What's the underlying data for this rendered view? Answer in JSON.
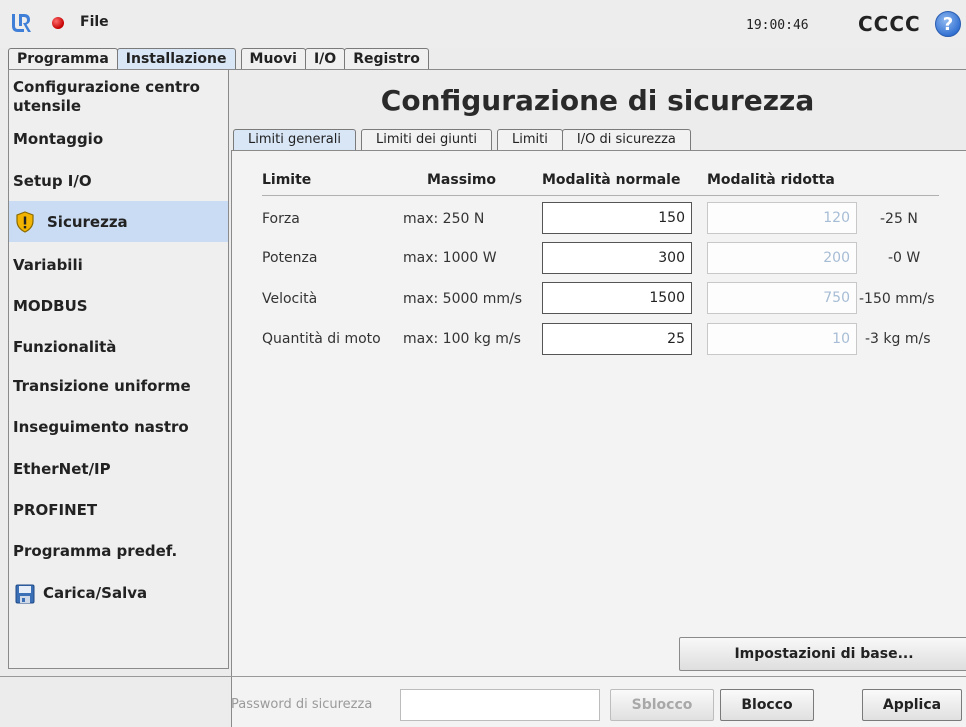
{
  "topbar": {
    "logo_icon": "ur-logo-icon",
    "status_icon": "record-red-icon",
    "file_label": "File",
    "clock": "19:00:46",
    "robot_name": "CCCC",
    "help_label": "?"
  },
  "main_tabs": [
    {
      "label": "Programma",
      "active": false
    },
    {
      "label": "Installazione",
      "active": true
    },
    {
      "label": "Muovi",
      "active": false
    },
    {
      "label": "I/O",
      "active": false
    },
    {
      "label": "Registro",
      "active": false
    }
  ],
  "sidebar": {
    "items": [
      {
        "label": "Configurazione centro utensile"
      },
      {
        "label": "Montaggio"
      },
      {
        "label": "Setup I/O"
      },
      {
        "label": "Sicurezza",
        "active": true,
        "icon": "warning-shield-icon"
      },
      {
        "label": "Variabili"
      },
      {
        "label": "MODBUS"
      },
      {
        "label": "Funzionalità"
      },
      {
        "label": "Transizione uniforme"
      },
      {
        "label": "Inseguimento nastro"
      },
      {
        "label": "EtherNet/IP"
      },
      {
        "label": "PROFINET"
      },
      {
        "label": "Programma predef."
      },
      {
        "label": "Carica/Salva",
        "icon": "floppy-disk-icon"
      }
    ]
  },
  "main": {
    "title": "Configurazione di sicurezza",
    "subtabs": [
      {
        "label": "Limiti generali",
        "active": true
      },
      {
        "label": "Limiti dei giunti"
      },
      {
        "label": "Limiti"
      },
      {
        "label": "I/O di sicurezza"
      }
    ],
    "columns": {
      "limit": "Limite",
      "max": "Massimo",
      "normal": "Modalità normale",
      "reduced": "Modalità ridotta"
    },
    "rows": [
      {
        "name": "Forza",
        "max": "max: 250 N",
        "normal": "150",
        "reduced": "120",
        "delta": "-25 N"
      },
      {
        "name": "Potenza",
        "max": "max: 1000 W",
        "normal": "300",
        "reduced": "200",
        "delta": "-0 W"
      },
      {
        "name": "Velocità",
        "max": "max: 5000 mm/s",
        "normal": "1500",
        "reduced": "750",
        "delta": "-150 mm/s"
      },
      {
        "name": "Quantità di moto",
        "max": "max: 100 kg m/s",
        "normal": "25",
        "reduced": "10",
        "delta": "-3 kg m/s"
      }
    ],
    "base_settings_button": "Impostazioni di base..."
  },
  "footer": {
    "password_label": "Password di sicurezza",
    "password_value": "",
    "unlock_button": "Sblocco",
    "lock_button": "Blocco",
    "apply_button": "Applica"
  },
  "colors": {
    "active_tab": "#d9e6f6",
    "active_sidebar": "#c9dcf3",
    "readonly_text": "#a7bdd5",
    "record": "#c40000",
    "help": "#2f6fd1"
  }
}
